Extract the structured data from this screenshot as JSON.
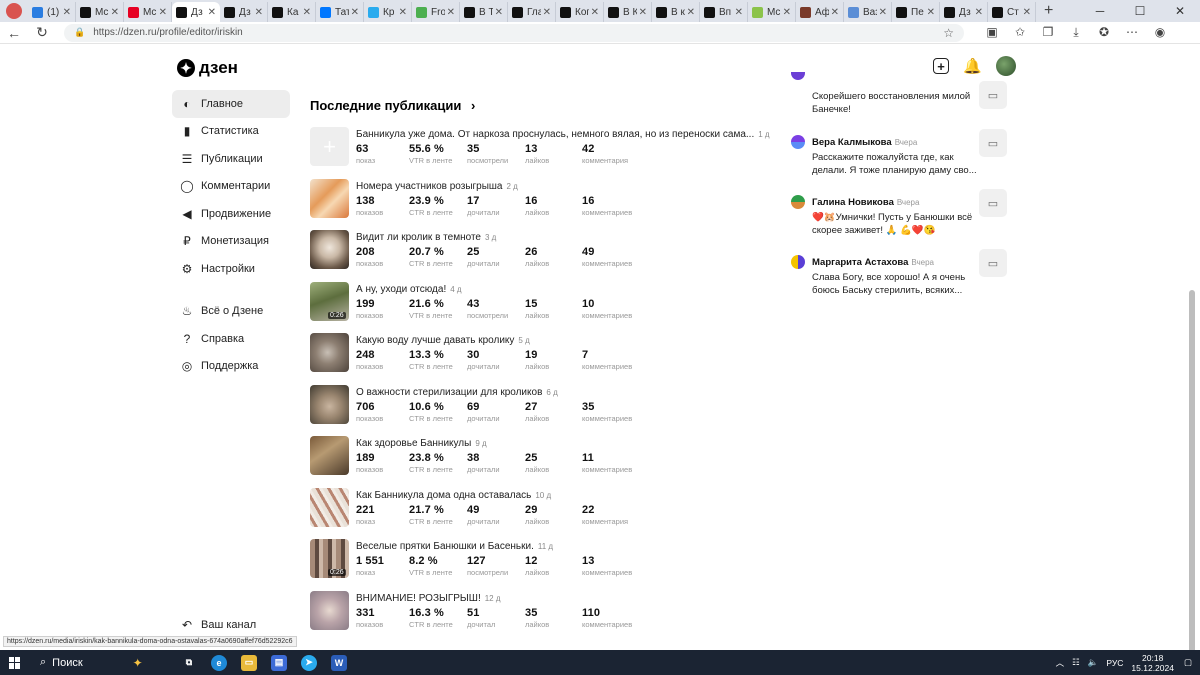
{
  "browser": {
    "tabs": [
      {
        "label": "(1)",
        "color": "#2a7de1"
      },
      {
        "label": "Mc",
        "color": "#111111"
      },
      {
        "label": "Mc",
        "color": "#e60023"
      },
      {
        "label": "Дз",
        "color": "#111111",
        "active": true
      },
      {
        "label": "Дз",
        "color": "#111111"
      },
      {
        "label": "Ка",
        "color": "#111111"
      },
      {
        "label": "Тат",
        "color": "#0077ff"
      },
      {
        "label": "Кр",
        "color": "#2aabee"
      },
      {
        "label": "Fro",
        "color": "#4caf50"
      },
      {
        "label": "В Т",
        "color": "#111111"
      },
      {
        "label": "Гла",
        "color": "#111111"
      },
      {
        "label": "Ког",
        "color": "#111111"
      },
      {
        "label": "В К",
        "color": "#111111"
      },
      {
        "label": "В к",
        "color": "#111111"
      },
      {
        "label": "Вп",
        "color": "#111111"
      },
      {
        "label": "Mc",
        "color": "#8bc34a"
      },
      {
        "label": "Аф",
        "color": "#7a3a2a"
      },
      {
        "label": "Ваз",
        "color": "#5b8ed6"
      },
      {
        "label": "Пе",
        "color": "#111111"
      },
      {
        "label": "Дз",
        "color": "#111111"
      },
      {
        "label": "Ст",
        "color": "#111111"
      }
    ],
    "url": "https://dzen.ru/profile/editor/iriskin",
    "status_url": "https://dzen.ru/media/iriskin/kak-bannikula-doma-odna-ostavalas-674a0690affef76d52292c6"
  },
  "header": {
    "logo_text": "дзен"
  },
  "sidebar": {
    "items": [
      {
        "label": "Главное",
        "icon": "planet-icon",
        "glyph": "◐",
        "active": true
      },
      {
        "label": "Статистика",
        "icon": "bar-chart-icon",
        "glyph": "▮"
      },
      {
        "label": "Публикации",
        "icon": "publications-icon",
        "glyph": "☰"
      },
      {
        "label": "Комментарии",
        "icon": "comment-icon",
        "glyph": "◯"
      },
      {
        "label": "Продвижение",
        "icon": "megaphone-icon",
        "glyph": "◀"
      },
      {
        "label": "Монетизация",
        "icon": "ruble-icon",
        "glyph": "₽"
      },
      {
        "label": "Настройки",
        "icon": "gear-icon",
        "glyph": "⚙"
      }
    ],
    "secondary": [
      {
        "label": "Всё о Дзене",
        "icon": "flame-icon",
        "glyph": "♨"
      },
      {
        "label": "Справка",
        "icon": "help-icon",
        "glyph": "?"
      },
      {
        "label": "Поддержка",
        "icon": "chat-icon",
        "glyph": "◎"
      }
    ],
    "bottom": {
      "label": "Ваш канал",
      "icon": "channel-icon",
      "glyph": "↶"
    }
  },
  "publications": {
    "title": "Последние публикации",
    "items": [
      {
        "title": "Банникула уже дома. От наркоза проснулась, немного вялая, но из переноски сама...",
        "age": "1 д",
        "thumb": "placeholder",
        "duration": "",
        "stats": [
          {
            "v": "63",
            "l": "показ"
          },
          {
            "v": "55.6 %",
            "l": "VTR в ленте"
          },
          {
            "v": "35",
            "l": "посмотрели"
          },
          {
            "v": "13",
            "l": "лайков"
          },
          {
            "v": "42",
            "l": "комментария"
          }
        ]
      },
      {
        "title": "Номера участников розыгрыша",
        "age": "2 д",
        "thumb": "linear-gradient(135deg,#f3e2cc 0%,#e59b5a 40%,#f7d8b2 60%,#d9773a 100%)",
        "duration": "",
        "stats": [
          {
            "v": "138",
            "l": "показов"
          },
          {
            "v": "23.9 %",
            "l": "CTR в ленте"
          },
          {
            "v": "17",
            "l": "дочитали"
          },
          {
            "v": "16",
            "l": "лайков"
          },
          {
            "v": "16",
            "l": "комментариев"
          }
        ]
      },
      {
        "title": "Видит ли кролик в темноте",
        "age": "3 д",
        "thumb": "radial-gradient(circle at 50% 45%,#efe6dc 0%,#c9b8a6 35%,#6c5a4a 70%,#2c2520 100%)",
        "duration": "",
        "stats": [
          {
            "v": "208",
            "l": "показов"
          },
          {
            "v": "20.7 %",
            "l": "CTR в ленте"
          },
          {
            "v": "25",
            "l": "дочитали"
          },
          {
            "v": "26",
            "l": "лайков"
          },
          {
            "v": "49",
            "l": "комментариев"
          }
        ]
      },
      {
        "title": "А ну, уходи отсюда!",
        "age": "4 д",
        "thumb": "linear-gradient(160deg,#9fb07c 0%,#5d6e3e 45%,#b8b3a4 100%)",
        "duration": "0:26",
        "stats": [
          {
            "v": "199",
            "l": "показов"
          },
          {
            "v": "21.6 %",
            "l": "VTR в ленте"
          },
          {
            "v": "43",
            "l": "посмотрели"
          },
          {
            "v": "15",
            "l": "лайков"
          },
          {
            "v": "10",
            "l": "комментариев"
          }
        ]
      },
      {
        "title": "Какую воду лучше давать кролику",
        "age": "5 д",
        "thumb": "radial-gradient(circle at 45% 50%,#c8bfb5 0%,#8d7f72 40%,#4d433b 100%)",
        "duration": "",
        "stats": [
          {
            "v": "248",
            "l": "показов"
          },
          {
            "v": "13.3 %",
            "l": "CTR в ленте"
          },
          {
            "v": "30",
            "l": "дочитали"
          },
          {
            "v": "19",
            "l": "лайков"
          },
          {
            "v": "7",
            "l": "комментариев"
          }
        ]
      },
      {
        "title": "О важности стерилизации для кроликов",
        "age": "6 д",
        "thumb": "radial-gradient(circle at 50% 55%,#c9b5a0 0%,#9a8670 40%,#3f3a30 100%)",
        "duration": "",
        "stats": [
          {
            "v": "706",
            "l": "показов"
          },
          {
            "v": "10.6 %",
            "l": "CTR в ленте"
          },
          {
            "v": "69",
            "l": "дочитали"
          },
          {
            "v": "27",
            "l": "лайков"
          },
          {
            "v": "35",
            "l": "комментариев"
          }
        ]
      },
      {
        "title": "Как здоровье Банникулы",
        "age": "9 д",
        "thumb": "linear-gradient(145deg,#7a5a3a 0%,#b79a72 40%,#4b3a2a 100%)",
        "duration": "",
        "stats": [
          {
            "v": "189",
            "l": "показов"
          },
          {
            "v": "23.8 %",
            "l": "CTR в ленте"
          },
          {
            "v": "38",
            "l": "дочитали"
          },
          {
            "v": "25",
            "l": "лайков"
          },
          {
            "v": "11",
            "l": "комментариев"
          }
        ]
      },
      {
        "title": "Как Банникула дома одна оставалась",
        "age": "10 д",
        "thumb": "repeating-linear-gradient(60deg,#e9e1d8 0 4px,#b98672 4px 7px,#f2ece6 7px 10px)",
        "duration": "",
        "stats": [
          {
            "v": "221",
            "l": "показ"
          },
          {
            "v": "21.7 %",
            "l": "CTR в ленте"
          },
          {
            "v": "49",
            "l": "дочитали"
          },
          {
            "v": "29",
            "l": "лайков"
          },
          {
            "v": "22",
            "l": "комментария"
          }
        ]
      },
      {
        "title": "Веселые прятки Банюшки и Басеньки.",
        "age": "11 д",
        "thumb": "repeating-linear-gradient(90deg,#a68a78 0 5px,#5e4a40 5px 9px,#cdb8a8 9px 13px)",
        "duration": "0:26",
        "stats": [
          {
            "v": "1 551",
            "l": "показ"
          },
          {
            "v": "8.2 %",
            "l": "VTR в ленте"
          },
          {
            "v": "127",
            "l": "посмотрели"
          },
          {
            "v": "12",
            "l": "лайков"
          },
          {
            "v": "13",
            "l": "комментариев"
          }
        ]
      },
      {
        "title": "ВНИМАНИЕ! РОЗЫГРЫШ!",
        "age": "12 д",
        "thumb": "radial-gradient(circle at 50% 50%,#e7d9d0 0%,#b9a3a8 45%,#8a7c86 100%)",
        "duration": "",
        "stats": [
          {
            "v": "331",
            "l": "показов"
          },
          {
            "v": "16.3 %",
            "l": "CTR в ленте"
          },
          {
            "v": "51",
            "l": "дочитал"
          },
          {
            "v": "35",
            "l": "лайков"
          },
          {
            "v": "110",
            "l": "комментариев"
          }
        ]
      }
    ]
  },
  "comments": {
    "partial_text": "Скорейшего восстановления милой Банечке!",
    "items": [
      {
        "name": "Вера Калмыкова",
        "when": "Вчера",
        "text": "Расскажите пожалуйста где, как делали. Я тоже планирую даму сво...",
        "avatar": "linear-gradient(180deg,#7b3fe4 50%,#5b8cf6 50%)"
      },
      {
        "name": "Галина Новикова",
        "when": "Вчера",
        "text": "❤️🐹Умнички! Пусть у Банюшки всё скорее заживет! 🙏 💪❤️😘",
        "avatar": "linear-gradient(180deg,#2e9d4a 50%,#d98a3a 50%)"
      },
      {
        "name": "Маргарита Астахова",
        "when": "Вчера",
        "text": "Слава Богу, все хорошо! А я очень боюсь Баську стерилить, всяких...",
        "avatar": "linear-gradient(90deg,#f5c400 50%,#5a3fd6 50%)"
      }
    ]
  },
  "taskbar": {
    "search_label": "Поиск",
    "lang": "РУС",
    "time": "20:18",
    "date": "15.12.2024"
  }
}
